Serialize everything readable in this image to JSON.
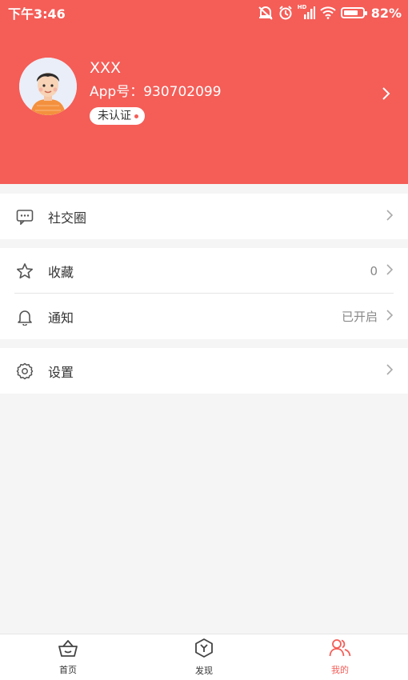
{
  "status_bar": {
    "time": "下午3:46",
    "network_label": "HD",
    "battery_text": "82%",
    "battery_level": 0.82
  },
  "profile": {
    "name": "XXX",
    "app_id": "App号：930702099",
    "badge": "未认证"
  },
  "menu": {
    "social": {
      "label": "社交圈",
      "icon": "chat-bubble-icon"
    },
    "favorites": {
      "label": "收藏",
      "value": "0",
      "icon": "star-icon"
    },
    "notifications": {
      "label": "通知",
      "value": "已开启",
      "icon": "bell-icon"
    },
    "settings": {
      "label": "设置",
      "icon": "gear-icon"
    }
  },
  "bottom_nav": {
    "home": {
      "label": "首页",
      "icon": "basket-icon"
    },
    "discover": {
      "label": "发现",
      "icon": "hexagon-icon"
    },
    "mine": {
      "label": "我的",
      "icon": "users-icon"
    }
  },
  "colors": {
    "accent": "#f55d57",
    "background": "#f5f5f5"
  }
}
